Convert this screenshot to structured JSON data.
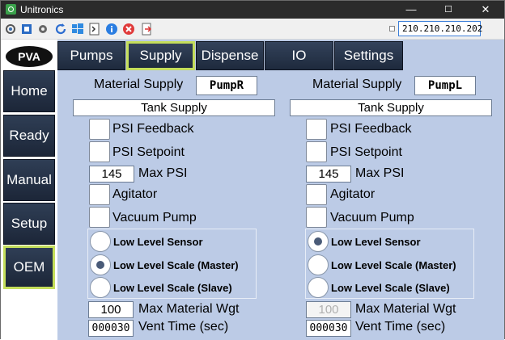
{
  "window": {
    "title": "Unitronics",
    "ip": "210.210.210.202"
  },
  "titlebar_buttons": {
    "minimize": "—",
    "maximize": "☐",
    "close": "✕"
  },
  "toolbar": {
    "icons": [
      "connect-icon",
      "fullscreen-icon",
      "settings-icon",
      "refresh-icon",
      "windows-icon",
      "terminal-icon",
      "info-icon",
      "stop-icon",
      "exit-icon"
    ]
  },
  "logo": {
    "text": "PVA"
  },
  "nav": {
    "items": [
      "Home",
      "Ready",
      "Manual",
      "Setup",
      "OEM"
    ],
    "active": "OEM"
  },
  "tabs": {
    "items": [
      "Pumps",
      "Supply",
      "Dispense",
      "IO",
      "Settings"
    ],
    "active": "Supply"
  },
  "left": {
    "material_supply_label": "Material Supply",
    "pump": "PumpR",
    "tank": "Tank Supply",
    "psi_feedback": "PSI Feedback",
    "psi_setpoint": "PSI Setpoint",
    "max_psi_value": "145",
    "max_psi_label": "Max PSI",
    "agitator": "Agitator",
    "vacuum_pump": "Vacuum Pump",
    "radios": [
      "Low Level Sensor",
      "Low Level Scale (Master)",
      "Low Level Scale (Slave)"
    ],
    "radio_selected": "Low Level Scale (Master)",
    "max_wgt_value": "100",
    "max_wgt_label": "Max Material Wgt",
    "vent_value": "000030",
    "vent_label": "Vent Time (sec)"
  },
  "right": {
    "material_supply_label": "Material Supply",
    "pump": "PumpL",
    "tank": "Tank Supply",
    "psi_feedback": "PSI Feedback",
    "psi_setpoint": "PSI Setpoint",
    "max_psi_value": "145",
    "max_psi_label": "Max PSI",
    "agitator": "Agitator",
    "vacuum_pump": "Vacuum Pump",
    "radios": [
      "Low Level Sensor",
      "Low Level Scale (Master)",
      "Low Level Scale (Slave)"
    ],
    "radio_selected": "Low Level Sensor",
    "max_wgt_value": "100",
    "max_wgt_label": "Max Material Wgt",
    "vent_value": "000030",
    "vent_label": "Vent Time (sec)"
  },
  "colors": {
    "panel_bg": "#bccbe6",
    "button_dark": "#1e2a3d",
    "active_border": "#c4de5b"
  }
}
